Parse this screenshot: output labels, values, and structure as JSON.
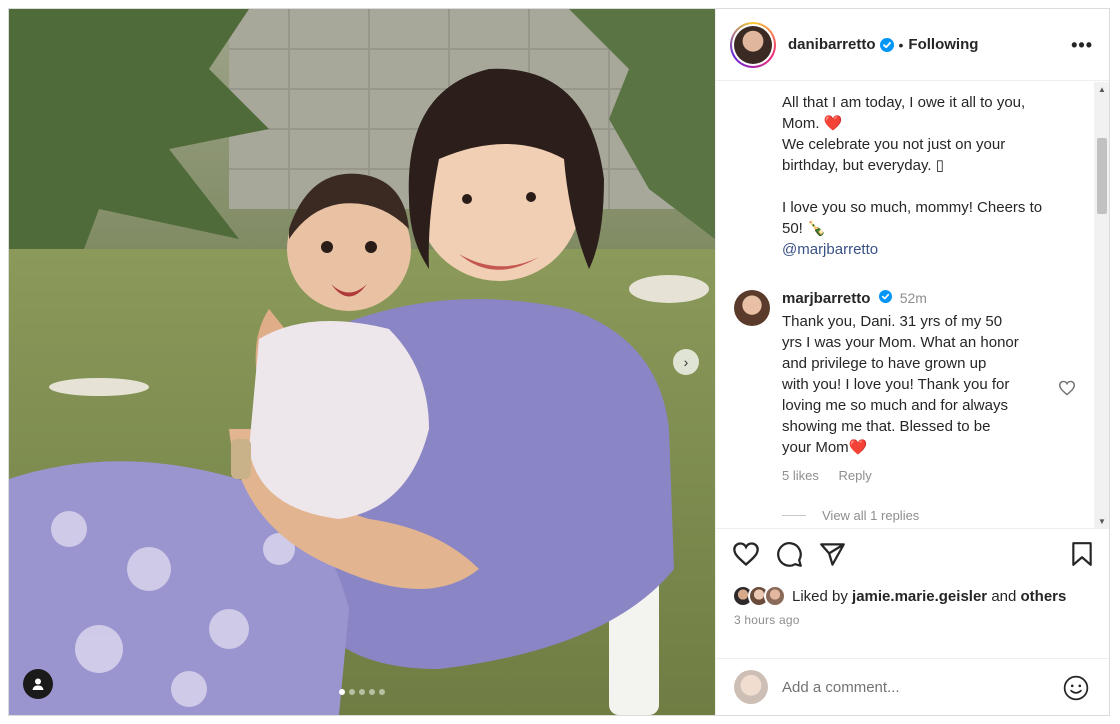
{
  "post": {
    "username": "danibarretto",
    "separator": "•",
    "follow_status": "Following",
    "more_label": "•••",
    "caption_lines": [
      "All that I am today, I owe it all to you,",
      "Mom.",
      "We celebrate you not just on your",
      "birthday, but everyday. ▯",
      "",
      "I love you so much, mommy! Cheers to",
      "50! 🍾",
      "@marjbarretto"
    ],
    "caption_heart": "❤️"
  },
  "carousel": {
    "total_slides": 5,
    "active_index": 0,
    "next_label": "›"
  },
  "comment": {
    "username": "marjbarretto",
    "time": "52m",
    "text_lines": [
      "Thank you, Dani. 31 yrs of my 50",
      "yrs I was your Mom. What an honor",
      "and privilege to have grown up",
      "with you! I love you! Thank you for",
      "loving me so much and for always",
      "showing me that. Blessed to be",
      "your Mom❤️"
    ],
    "likes": "5 likes",
    "reply_label": "Reply",
    "view_replies": "View all 1 replies"
  },
  "likes_section": {
    "prefix": "Liked by",
    "user": "jamie.marie.geisler",
    "connector": "and",
    "others": "others",
    "time_ago": "3 hours ago"
  },
  "add_comment": {
    "placeholder": "Add a comment..."
  },
  "icons": [
    "verified-icon",
    "more-icon",
    "heart-icon",
    "comment-icon",
    "share-icon",
    "bookmark-icon",
    "emoji-icon",
    "user-tag-icon",
    "chevron-right-icon"
  ],
  "colors": {
    "verified": "#0095f6",
    "mention": "#385185",
    "muted": "#8e8e8e",
    "heart": "#e0213c"
  }
}
